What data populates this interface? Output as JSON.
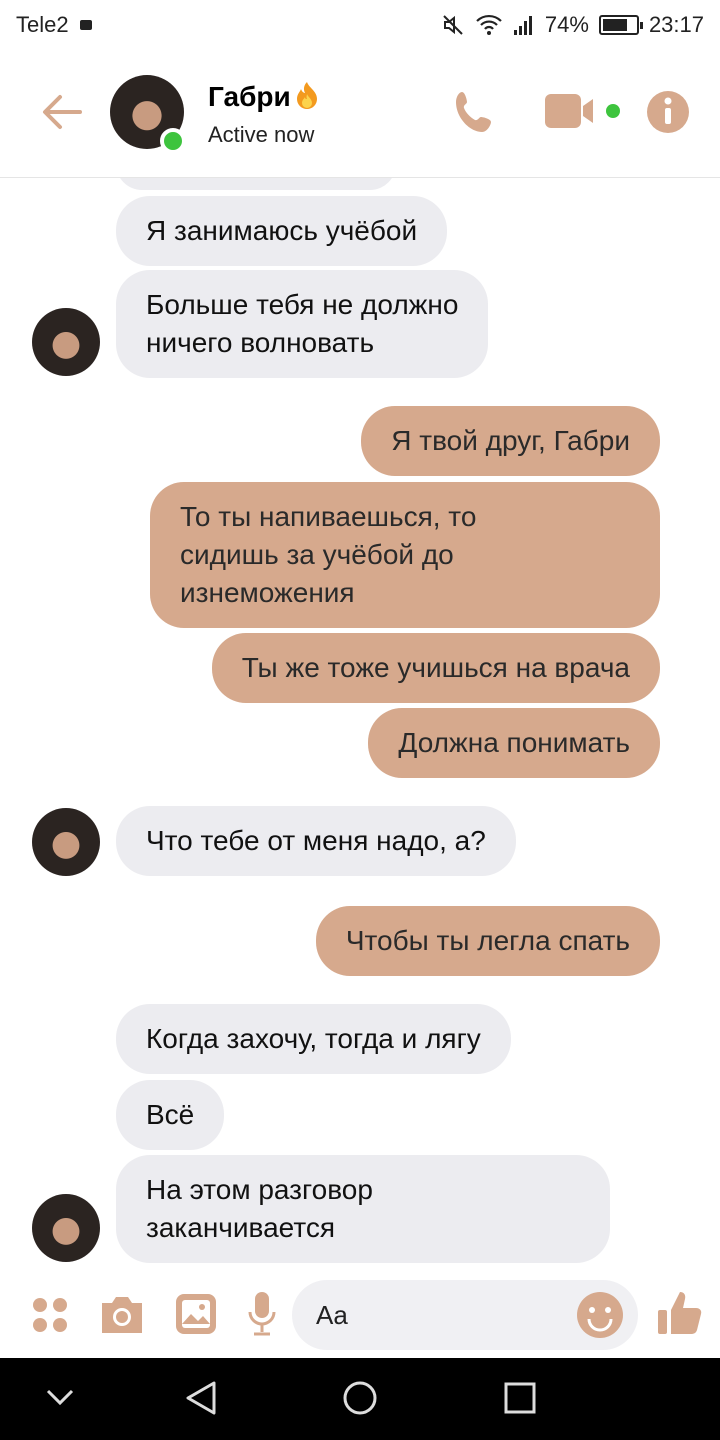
{
  "status_bar": {
    "carrier": "Tele2",
    "battery": "74%",
    "battery_level": 0.74,
    "time": "23:17"
  },
  "header": {
    "name": "Габри",
    "status": "Active now"
  },
  "messages": [
    {
      "dir": "in",
      "text": "Я занимаюсь учёбой"
    },
    {
      "dir": "in",
      "text": "Больше тебя не должно\nничего волновать"
    },
    {
      "dir": "out",
      "text": "Я твой друг, Габри"
    },
    {
      "dir": "out",
      "text": "То ты напиваешься, то\nсидишь за учёбой до\nизнеможения"
    },
    {
      "dir": "out",
      "text": "Ты же тоже учишься на врача"
    },
    {
      "dir": "out",
      "text": "Должна понимать"
    },
    {
      "dir": "in",
      "text": "Что тебе от меня надо, а?"
    },
    {
      "dir": "out",
      "text": "Чтобы ты легла спать"
    },
    {
      "dir": "in",
      "text": "Когда захочу, тогда и лягу"
    },
    {
      "dir": "in",
      "text": "Всё"
    },
    {
      "dir": "in",
      "text": "На этом разговор\nзаканчивается"
    }
  ],
  "composer": {
    "placeholder": "Aa"
  },
  "colors": {
    "accent": "#d6a98d",
    "incoming": "#ececf0",
    "online": "#3ec43e"
  },
  "icons": [
    "back-arrow-icon",
    "phone-icon",
    "video-call-icon",
    "info-icon",
    "apps-icon",
    "camera-icon",
    "gallery-icon",
    "microphone-icon",
    "emoji-icon",
    "thumbs-up-icon",
    "nav-back-icon",
    "nav-home-icon",
    "nav-recents-icon",
    "nav-collapse-icon"
  ]
}
